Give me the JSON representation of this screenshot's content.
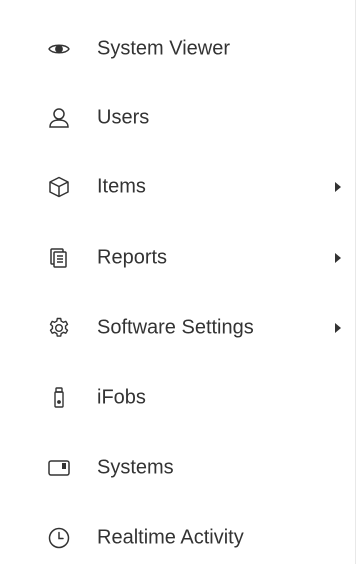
{
  "menu": {
    "items": [
      {
        "label": "System Viewer",
        "icon": "eye-icon",
        "has_submenu": false
      },
      {
        "label": "Users",
        "icon": "user-icon",
        "has_submenu": false
      },
      {
        "label": "Items",
        "icon": "cube-icon",
        "has_submenu": true
      },
      {
        "label": "Reports",
        "icon": "documents-icon",
        "has_submenu": true
      },
      {
        "label": "Software Settings",
        "icon": "gear-icon",
        "has_submenu": true
      },
      {
        "label": "iFobs",
        "icon": "fob-icon",
        "has_submenu": false
      },
      {
        "label": "Systems",
        "icon": "panel-icon",
        "has_submenu": false
      },
      {
        "label": "Realtime Activity",
        "icon": "clock-icon",
        "has_submenu": false
      }
    ]
  },
  "colors": {
    "text": "#333333",
    "background": "#ffffff"
  }
}
